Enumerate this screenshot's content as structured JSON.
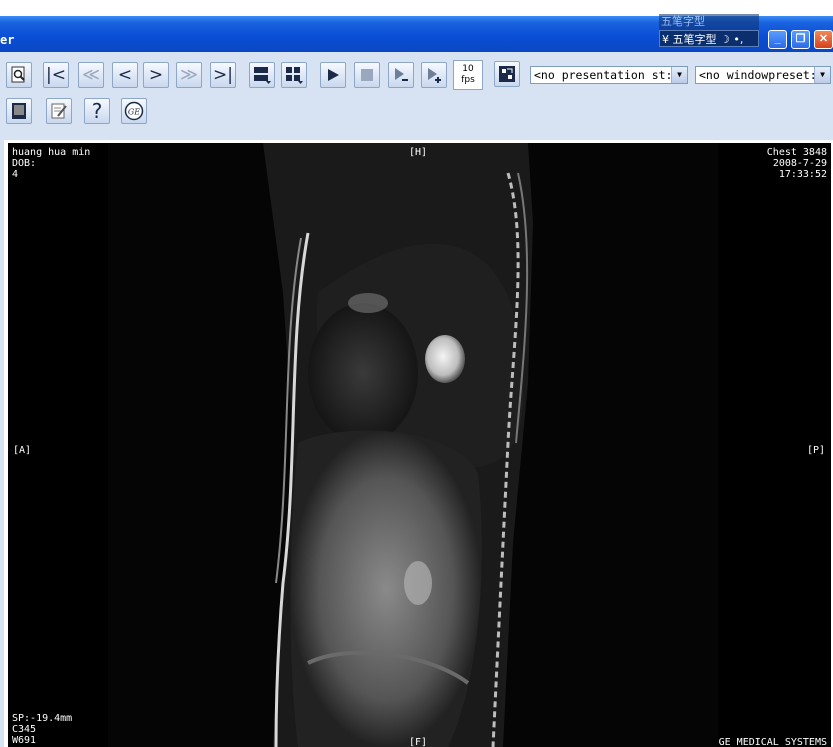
{
  "window": {
    "title": "er",
    "ime_label": "五笔字型",
    "ime_label_shadow": "五笔字型",
    "ime_extra": "☽ •,"
  },
  "toolbar": {
    "fps_value": "10",
    "fps_unit": "fps",
    "presentation_select": "<no presentation st:",
    "window_preset_select": "<no windowpreset:"
  },
  "overlay": {
    "patient_name": "huang hua min",
    "dob": "DOB:",
    "line3": "4",
    "study": "Chest 3848",
    "date": "2008-7-29",
    "time": "17:33:52",
    "orient_top": "[H]",
    "orient_left": "[A]",
    "orient_right": "[P]",
    "orient_bottom": "[F]",
    "sp": "SP:-19.4mm",
    "c": "C345",
    "w": "W691",
    "manufacturer": "GE MEDICAL SYSTEMS"
  },
  "icons": {
    "toolbar_row1": [
      "zoom-icon",
      "first-frame-icon",
      "fast-rewind-icon",
      "prev-frame-icon",
      "next-frame-icon",
      "fast-forward-icon",
      "last-frame-icon",
      "layout-1-icon",
      "layout-grid-icon",
      "play-icon",
      "stop-icon",
      "slower-icon",
      "faster-icon",
      "sync-icon"
    ],
    "toolbar_row2": [
      "film-icon",
      "notes-icon",
      "help-icon",
      "ge-logo-icon"
    ]
  },
  "colors": {
    "titlebar": "#0b4fd6",
    "toolbar_bg": "#d7e3f3",
    "image_bg": "#000000",
    "overlay_text": "#ffffff"
  }
}
